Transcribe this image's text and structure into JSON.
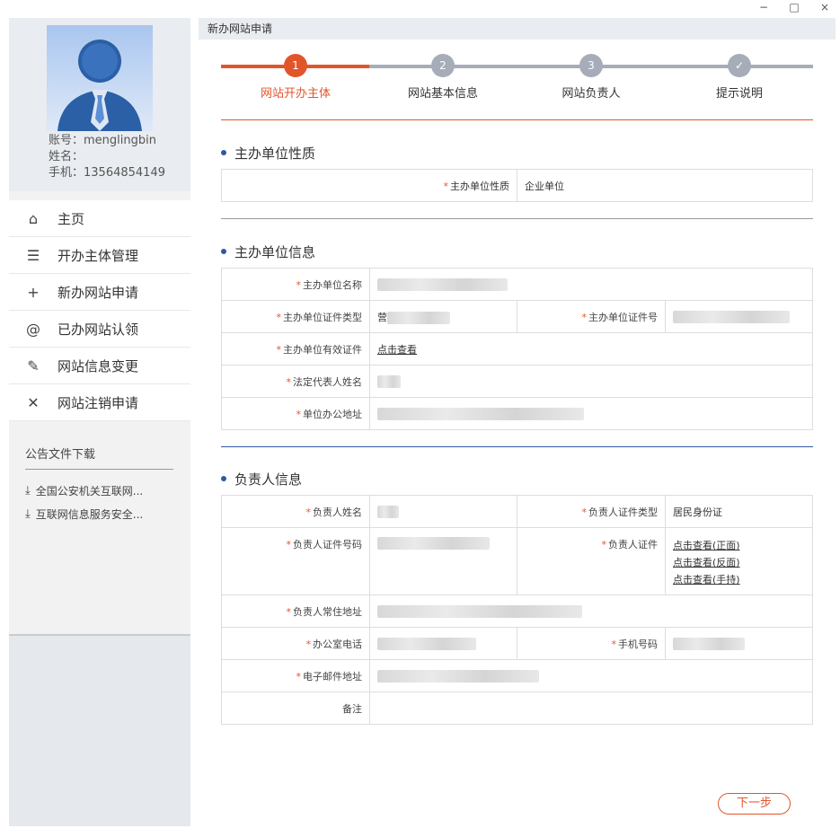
{
  "window": {
    "minimize": "−",
    "maximize": "□",
    "close": "×"
  },
  "user": {
    "account": "账号：menglingbin",
    "name": "姓名：",
    "phone": "手机：13564854149"
  },
  "menu": [
    {
      "icon": "⌂",
      "label": "主页"
    },
    {
      "icon": "☰",
      "label": "开办主体管理"
    },
    {
      "icon": "+",
      "label": "新办网站申请"
    },
    {
      "icon": "@",
      "label": "已办网站认领"
    },
    {
      "icon": "✎",
      "label": "网站信息变更"
    },
    {
      "icon": "✕",
      "label": "网站注销申请"
    }
  ],
  "notices": {
    "title": "公告文件下载",
    "items": [
      {
        "icon": "⤓",
        "label": "全国公安机关互联网..."
      },
      {
        "icon": "⤓",
        "label": "互联网信息服务安全..."
      }
    ]
  },
  "main": {
    "title": "新办网站申请",
    "steps": [
      {
        "num": "1",
        "label": "网站开办主体"
      },
      {
        "num": "2",
        "label": "网站基本信息"
      },
      {
        "num": "3",
        "label": "网站负责人"
      },
      {
        "num": "✓",
        "label": "提示说明"
      }
    ]
  },
  "section1": {
    "title": "主办单位性质",
    "label": "主办单位性质",
    "value": "企业单位"
  },
  "section2": {
    "title": "主办单位信息",
    "name_label": "主办单位名称",
    "idtype_label": "主办单位证件类型",
    "idno_label": "主办单位证件号",
    "cert_label": "主办单位有效证件",
    "cert_link": "点击查看",
    "legal_label": "法定代表人姓名",
    "addr_label": "单位办公地址",
    "idtype_prefix": "营"
  },
  "section3": {
    "title": "负责人信息",
    "name_label": "负责人姓名",
    "idtype_label": "负责人证件类型",
    "idtype_value": "居民身份证",
    "idno_label": "负责人证件号码",
    "cert_label": "负责人证件",
    "cert_front": "点击查看(正面)",
    "cert_back": "点击查看(反面)",
    "cert_hand": "点击查看(手持)",
    "addr_label": "负责人常住地址",
    "office_label": "办公室电话",
    "mobile_label": "手机号码",
    "email_label": "电子邮件地址",
    "remark_label": "备注"
  },
  "next_button": "下一步",
  "required_mark": "*",
  "colors": {
    "accent": "#e2552b",
    "inactive": "#a6adb8",
    "dot": "#2d5aa0"
  }
}
